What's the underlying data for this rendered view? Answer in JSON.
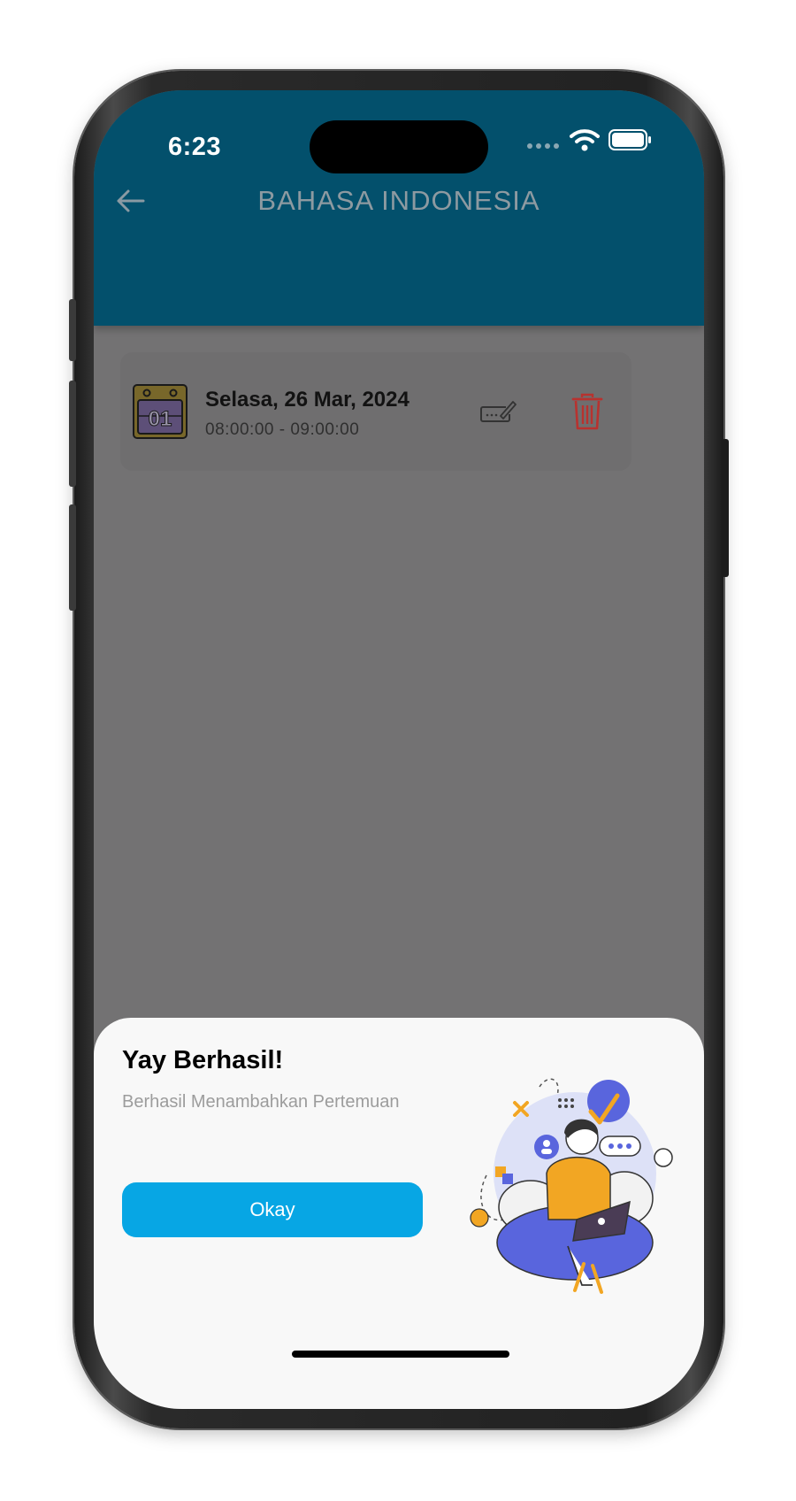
{
  "status_bar": {
    "time": "6:23",
    "icons": [
      "signal-icon",
      "wifi-icon",
      "battery-icon"
    ]
  },
  "header": {
    "title": "BAHASA INDONESIA",
    "back_icon": "arrow-left-icon",
    "background": "#03506c"
  },
  "meetings": [
    {
      "date": "Selasa, 26 Mar, 2024",
      "time": "08:00:00 - 09:00:00",
      "calendar_icon_text": "01"
    }
  ],
  "dialog": {
    "title": "Yay Berhasil!",
    "message": "Berhasil Menambahkan Pertemuan",
    "button_label": "Okay",
    "button_color": "#07a6e4"
  },
  "colors": {
    "delete": "#b8322f",
    "overlay": "#737273"
  }
}
